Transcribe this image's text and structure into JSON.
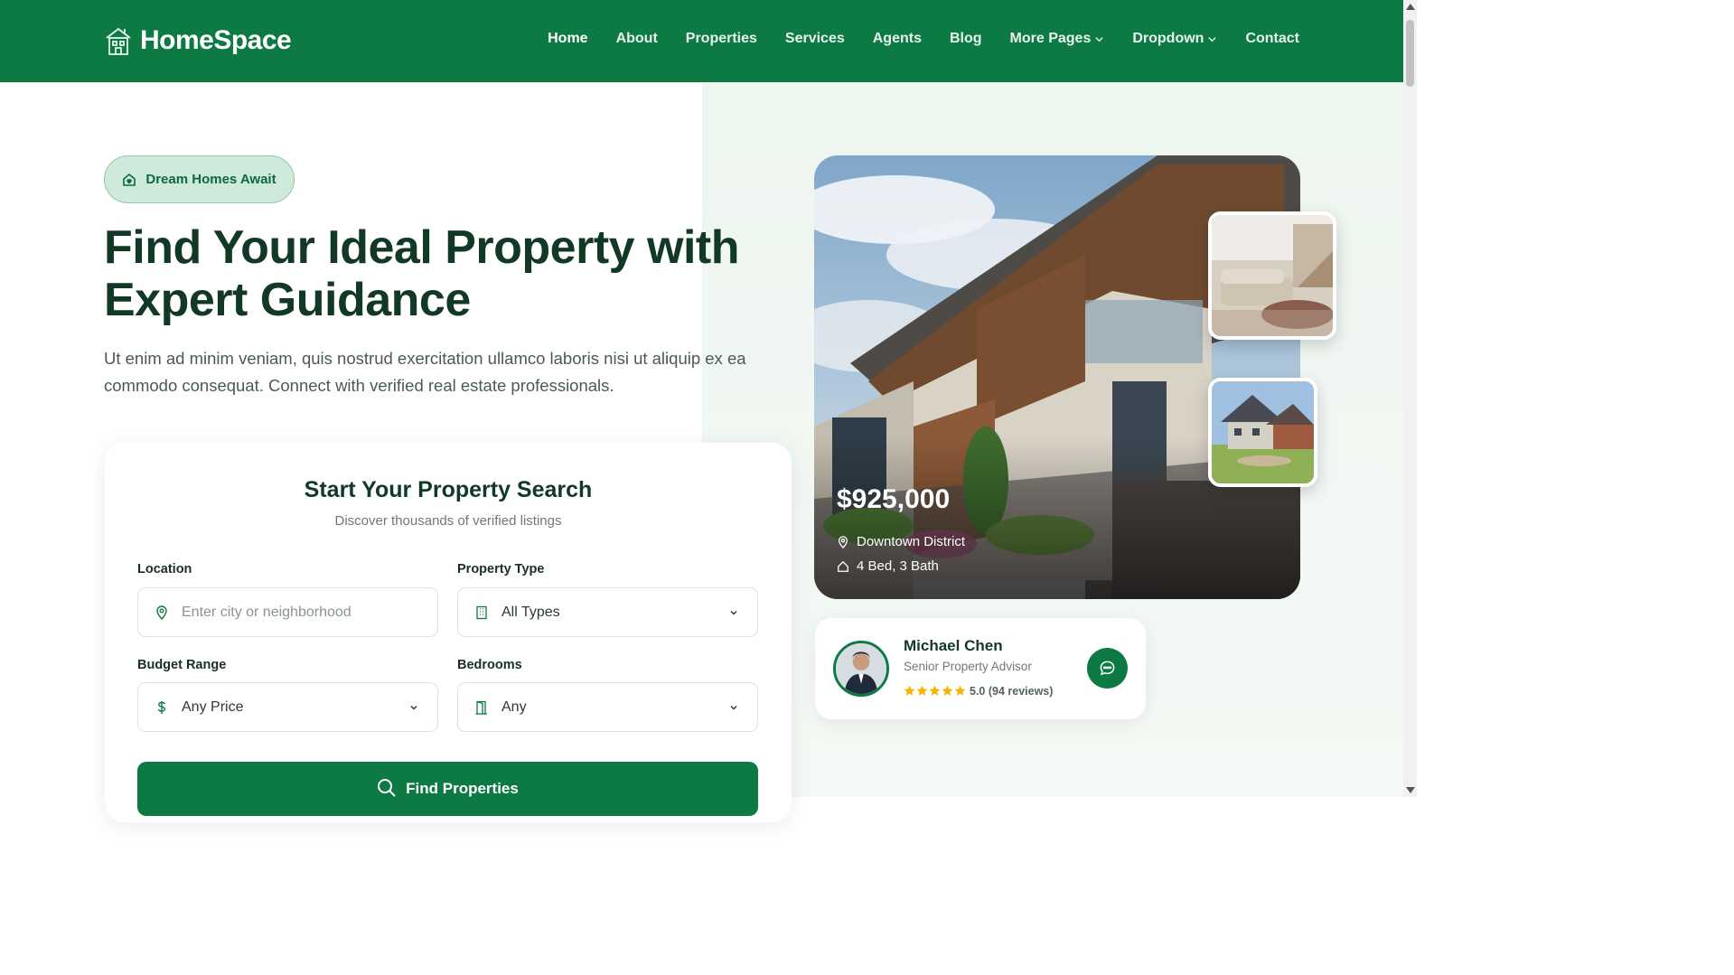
{
  "brand": {
    "name": "HomeSpace",
    "color": "#0d7a44"
  },
  "nav": {
    "items": [
      {
        "label": "Home",
        "active": true
      },
      {
        "label": "About"
      },
      {
        "label": "Properties"
      },
      {
        "label": "Services"
      },
      {
        "label": "Agents"
      },
      {
        "label": "Blog"
      },
      {
        "label": "More Pages",
        "dropdown": true
      },
      {
        "label": "Dropdown",
        "dropdown": true
      },
      {
        "label": "Contact"
      }
    ]
  },
  "hero": {
    "badge": "Dream Homes Await",
    "title_line1": "Find Your Ideal Property with",
    "title_line2": "Expert Guidance",
    "description": "Ut enim ad minim veniam, quis nostrud exercitation ullamco laboris nisi ut aliquip ex ea commodo consequat. Connect with verified real estate professionals."
  },
  "search": {
    "title": "Start Your Property Search",
    "subtitle": "Discover thousands of verified listings",
    "location": {
      "label": "Location",
      "placeholder": "Enter city or neighborhood"
    },
    "property_type": {
      "label": "Property Type",
      "value": "All Types"
    },
    "budget": {
      "label": "Budget Range",
      "value": "Any Price"
    },
    "bedrooms": {
      "label": "Bedrooms",
      "value": "Any"
    },
    "button": "Find Properties"
  },
  "featured": {
    "price": "$925,000",
    "location": "Downtown District",
    "specs": "4 Bed, 3 Bath"
  },
  "agent": {
    "name": "Michael Chen",
    "role": "Senior Property Advisor",
    "stars": 5,
    "rating": "5.0 (94 reviews)"
  }
}
